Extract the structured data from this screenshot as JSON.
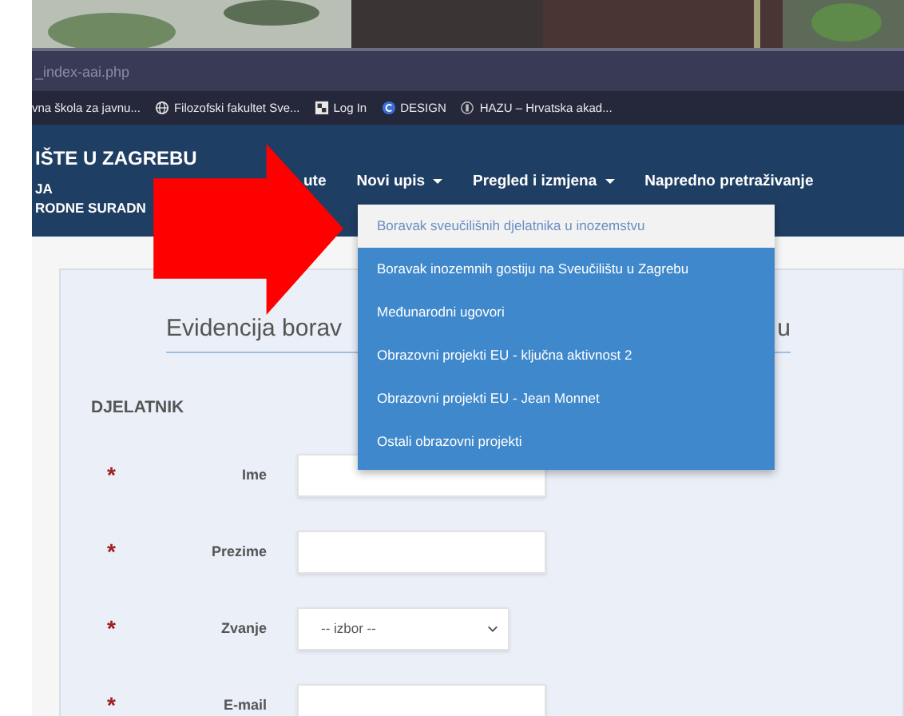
{
  "browser": {
    "address": "_index-aai.php",
    "bookmarks": [
      {
        "label": "vna škola za javnu...",
        "kind": "none"
      },
      {
        "label": "Filozofski fakultet Sve...",
        "kind": "globe"
      },
      {
        "label": "Log In",
        "kind": "square"
      },
      {
        "label": "DESIGN",
        "kind": "disc"
      },
      {
        "label": "HAZU – Hrvatska akad...",
        "kind": "emblem"
      }
    ]
  },
  "header": {
    "title": "IŠTE U ZAGREBU",
    "subtitle_lines": [
      "JA",
      "RODNE SURADN"
    ],
    "nav": [
      {
        "label": "ute",
        "has_caret": false
      },
      {
        "label": "Novi upis",
        "has_caret": true
      },
      {
        "label": "Pregled i izmjena",
        "has_caret": true
      },
      {
        "label": "Napredno pretraživanje",
        "has_caret": false
      }
    ]
  },
  "dropdown": {
    "items": [
      {
        "label": "Boravak sveučilišnih djelatnika u inozemstvu",
        "selected": true
      },
      {
        "label": "Boravak inozemnih gostiju na Sveučilištu u Zagrebu",
        "selected": false
      },
      {
        "label": "Međunarodni ugovori",
        "selected": false
      },
      {
        "label": "Obrazovni projekti EU - ključna aktivnost 2",
        "selected": false
      },
      {
        "label": "Obrazovni projekti EU - Jean Monnet",
        "selected": false
      },
      {
        "label": "Ostali obrazovni projekti",
        "selected": false
      }
    ]
  },
  "form": {
    "title_start": "Evidencija borav",
    "title_end": "u",
    "section": "DJELATNIK",
    "fields": [
      {
        "label": "Ime",
        "kind": "text",
        "required_mark": "*"
      },
      {
        "label": "Prezime",
        "kind": "text",
        "required_mark": "*"
      },
      {
        "label": "Zvanje",
        "kind": "select",
        "value": "-- izbor --",
        "required_mark": "*"
      },
      {
        "label": "E-mail",
        "kind": "text",
        "required_mark": "*"
      }
    ]
  }
}
